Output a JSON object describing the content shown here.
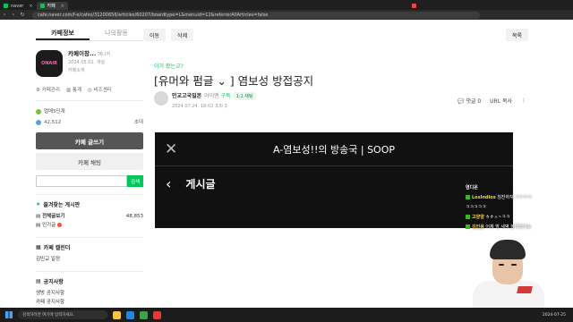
{
  "browser": {
    "tabs": [
      {
        "label": "naver",
        "active": false
      },
      {
        "label": "카페",
        "active": true
      },
      {
        "label": "",
        "active": false
      },
      {
        "label": "",
        "active": false
      }
    ],
    "url": "cafe.naver.com/f-e/cafes/31200656/articles/60207/boardtype=L&menuid=12&referrerAllArticles=false"
  },
  "sidebar": {
    "tab_cafe_info": "카페정보",
    "tab_my_activity": "나의활동",
    "cafe_logo_text": "ONAIR",
    "cafe_name": "카페이창...",
    "manager_label": "매니저",
    "since": "2024.05.01. 개설",
    "intro_label": "카페소개",
    "manage_label": "카페관리",
    "stats_label": "통계",
    "biz_label": "비즈센터",
    "level_label": "열매5단계",
    "member_count": "42,512",
    "invite_label": "초대",
    "write_button": "카페 글쓰기",
    "chat_button": "카페 채팅",
    "search_placeholder": "",
    "search_button": "검색",
    "fav_title": "즐겨찾는 게시판",
    "all_posts_label": "전체글보기",
    "all_posts_count": "48,853",
    "popular_label": "인기글",
    "calendar_title": "카페 캘린더",
    "calendar_item": "김민교 일정",
    "notice_title": "공지사항",
    "notice_items": [
      "생방 공지사항",
      "카페 공지사항"
    ]
  },
  "main": {
    "move_button": "이동",
    "delete_button": "삭제",
    "list_button": "목록",
    "category_link": "이거 봤는교?",
    "post_title": "[유머와 펌글 ⌄ ] 염보성 방접공지",
    "author_name": "민교고국일본",
    "author_grade": "아이엔",
    "author_level": "구독",
    "chat_label": "1:1 채팅",
    "post_date": "2024.07.24. 18:02",
    "view_label": "조회 3",
    "comment_label": "댓글 0",
    "url_copy_label": "URL 복사",
    "embed_title": "A-염보성!!의 방송국 | SOOP",
    "embed_label": "게시글"
  },
  "chat": {
    "header": "염디온",
    "lines": [
      {
        "user": "LosIndios",
        "text": "칭찬하자 ㅋㅋㅋㅋ"
      },
      {
        "user": "",
        "text": "ㅋㅋㅋㅋㅋ"
      },
      {
        "user": "고양양",
        "text": "ㅎㅎㅅ~ㅋㅋ"
      },
      {
        "user": "김인용",
        "text": "어제 밤 새벽 놀라웠어요"
      }
    ]
  },
  "taskbar": {
    "search_placeholder": "검색하려면 여기에 입력하세요.",
    "clock": "2024-07-25"
  },
  "colors": {
    "naver_green": "#03c75a",
    "dark_button": "#555555",
    "embed_bg": "#111111"
  }
}
